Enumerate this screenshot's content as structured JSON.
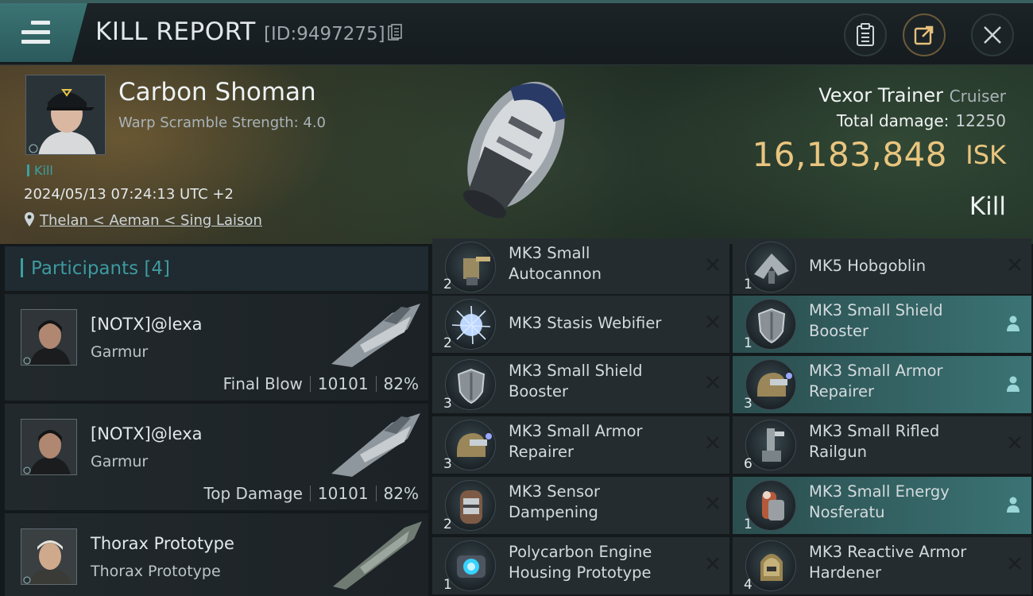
{
  "header": {
    "title": "KILL REPORT",
    "id_text": "[ID:9497275]",
    "icons": [
      "menu-icon",
      "copy-icon",
      "clipboard-icon",
      "share-icon",
      "close-icon"
    ]
  },
  "victim": {
    "name": "Carbon Shoman",
    "warp_scramble": "Warp Scramble Strength: 4.0",
    "tag": "Kill",
    "datetime": "2024/05/13 07:24:13 UTC +2",
    "location": "Thelan < Aeman < Sing Laison",
    "ship": "Vexor Trainer",
    "ship_class": "Cruiser",
    "total_damage_label": "Total damage:",
    "total_damage": "12250",
    "isk_value": "16,183,848",
    "isk_unit": "ISK",
    "result": "Kill"
  },
  "participants": {
    "title": "Participants [4]",
    "rows": [
      {
        "name": "[NOTX]@lexa",
        "ship": "Garmur",
        "role": "Final Blow",
        "damage": "10101",
        "percent": "82%"
      },
      {
        "name": "[NOTX]@lexa",
        "ship": "Garmur",
        "role": "Top Damage",
        "damage": "10101",
        "percent": "82%"
      },
      {
        "name": "Thorax Prototype",
        "ship": "Thorax Prototype"
      }
    ]
  },
  "modules": {
    "left": [
      {
        "qty": "2",
        "line1": "MK3 Small",
        "line2": "Autocannon",
        "icon": "autocannon-icon"
      },
      {
        "qty": "2",
        "line1": "MK3 Stasis Webifier",
        "line2": "",
        "icon": "stasis-webifier-icon"
      },
      {
        "qty": "3",
        "line1": "MK3 Small Shield",
        "line2": "Booster",
        "icon": "shield-booster-icon"
      },
      {
        "qty": "3",
        "line1": "MK3 Small Armor",
        "line2": "Repairer",
        "icon": "armor-repairer-icon"
      },
      {
        "qty": "2",
        "line1": "MK3 Sensor",
        "line2": "Dampening",
        "icon": "sensor-dampener-icon"
      },
      {
        "qty": "1",
        "line1": "Polycarbon Engine",
        "line2": "Housing Prototype",
        "icon": "engine-housing-icon"
      }
    ],
    "right": [
      {
        "qty": "1",
        "line1": "MK5  Hobgoblin",
        "line2": "",
        "icon": "drone-icon",
        "dropped": false
      },
      {
        "qty": "1",
        "line1": "MK3 Small Shield",
        "line2": "Booster",
        "icon": "shield-booster-icon",
        "dropped": true
      },
      {
        "qty": "3",
        "line1": "MK3 Small Armor",
        "line2": "Repairer",
        "icon": "armor-repairer-icon",
        "dropped": true
      },
      {
        "qty": "6",
        "line1": "MK3 Small Rifled",
        "line2": "Railgun",
        "icon": "railgun-icon",
        "dropped": false
      },
      {
        "qty": "1",
        "line1": "MK3 Small Energy",
        "line2": "Nosferatu",
        "icon": "nosferatu-icon",
        "dropped": true
      },
      {
        "qty": "4",
        "line1": "MK3 Reactive Armor",
        "line2": "Hardener",
        "icon": "armor-hardener-icon",
        "dropped": false
      }
    ]
  },
  "colors": {
    "accent": "#3aa0a2",
    "isk": "#e9c57f",
    "highlight": "#3b7374"
  }
}
